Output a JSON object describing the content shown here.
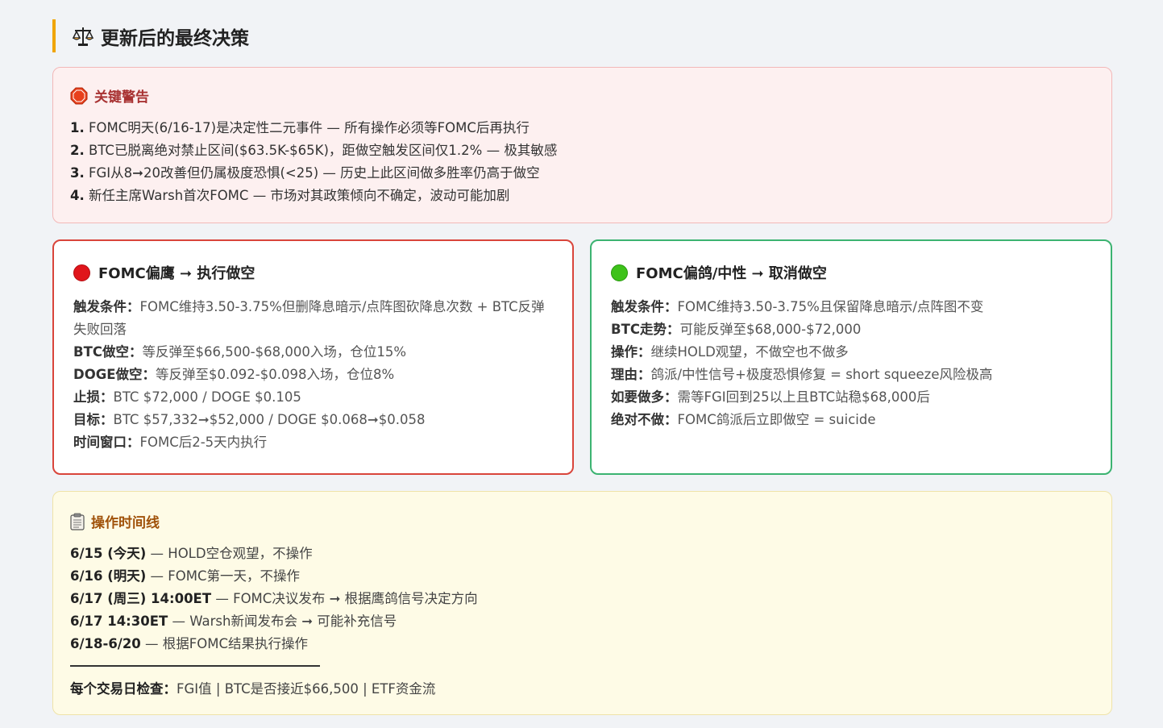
{
  "page": {
    "title": "更新后的最终决策"
  },
  "warning": {
    "title": "关键警告",
    "items": [
      {
        "num": "1.",
        "text": "FOMC明天(6/16-17)是决定性二元事件 — 所有操作必须等FOMC后再执行"
      },
      {
        "num": "2.",
        "text": "BTC已脱离绝对禁止区间($63.5K-$65K)，距做空触发区间仅1.2% — 极其敏感"
      },
      {
        "num": "3.",
        "text": "FGI从8➞20改善但仍属极度恐惧(<25) — 历史上此区间做多胜率仍高于做空"
      },
      {
        "num": "4.",
        "text": "新任主席Warsh首次FOMC — 市场对其政策倾向不确定，波动可能加剧"
      }
    ]
  },
  "hawk": {
    "title": "FOMC偏鹰 ➞ 执行做空",
    "rows": [
      {
        "label": "触发条件：",
        "value": "FOMC维持3.50-3.75%但删降息暗示/点阵图砍降息次数 + BTC反弹失败回落"
      },
      {
        "label": "BTC做空：",
        "value": "等反弹至$66,500-$68,000入场，仓位15%"
      },
      {
        "label": "DOGE做空：",
        "value": "等反弹至$0.092-$0.098入场，仓位8%"
      },
      {
        "label": "止损：",
        "value": "BTC $72,000 / DOGE $0.105"
      },
      {
        "label": "目标：",
        "value": "BTC $57,332➞$52,000 / DOGE $0.068➞$0.058"
      },
      {
        "label": "时间窗口：",
        "value": "FOMC后2-5天内执行"
      }
    ]
  },
  "dove": {
    "title": "FOMC偏鸽/中性 ➞ 取消做空",
    "rows": [
      {
        "label": "触发条件：",
        "value": "FOMC维持3.50-3.75%且保留降息暗示/点阵图不变"
      },
      {
        "label": "BTC走势：",
        "value": "可能反弹至$68,000-$72,000"
      },
      {
        "label": "操作：",
        "value": "继续HOLD观望，不做空也不做多"
      },
      {
        "label": "理由：",
        "value": "鸽派/中性信号+极度恐惧修复 = short squeeze风险极高"
      },
      {
        "label": "如要做多：",
        "value": "需等FGI回到25以上且BTC站稳$68,000后"
      },
      {
        "label": "绝对不做：",
        "value": "FOMC鸽派后立即做空 = suicide"
      }
    ]
  },
  "timeline": {
    "title": "操作时间线",
    "items": [
      {
        "date": "6/15 (今天)",
        "text": " — HOLD空仓观望，不操作"
      },
      {
        "date": "6/16 (明天)",
        "text": " — FOMC第一天，不操作"
      },
      {
        "date": "6/17 (周三) 14:00ET",
        "text": " — FOMC决议发布 ➞ 根据鹰鸽信号决定方向"
      },
      {
        "date": "6/17 14:30ET",
        "text": " — Warsh新闻发布会 ➞ 可能补充信号"
      },
      {
        "date": "6/18-6/20",
        "text": " — 根据FOMC结果执行操作"
      }
    ],
    "check_label": "每个交易日检查：",
    "check_text": "FGI值 | BTC是否接近$66,500 | ETF资金流"
  },
  "colors": {
    "accent": "#f0a500",
    "warning_bg": "#fdf0f0",
    "hawk_border": "#d9453b",
    "dove_border": "#3cb371",
    "timeline_bg": "#fefbe6"
  },
  "icons": {
    "title": "balance-scale-icon",
    "warning": "stop-sign-icon",
    "hawk": "red-circle-icon",
    "dove": "green-circle-icon",
    "timeline": "clipboard-icon"
  }
}
